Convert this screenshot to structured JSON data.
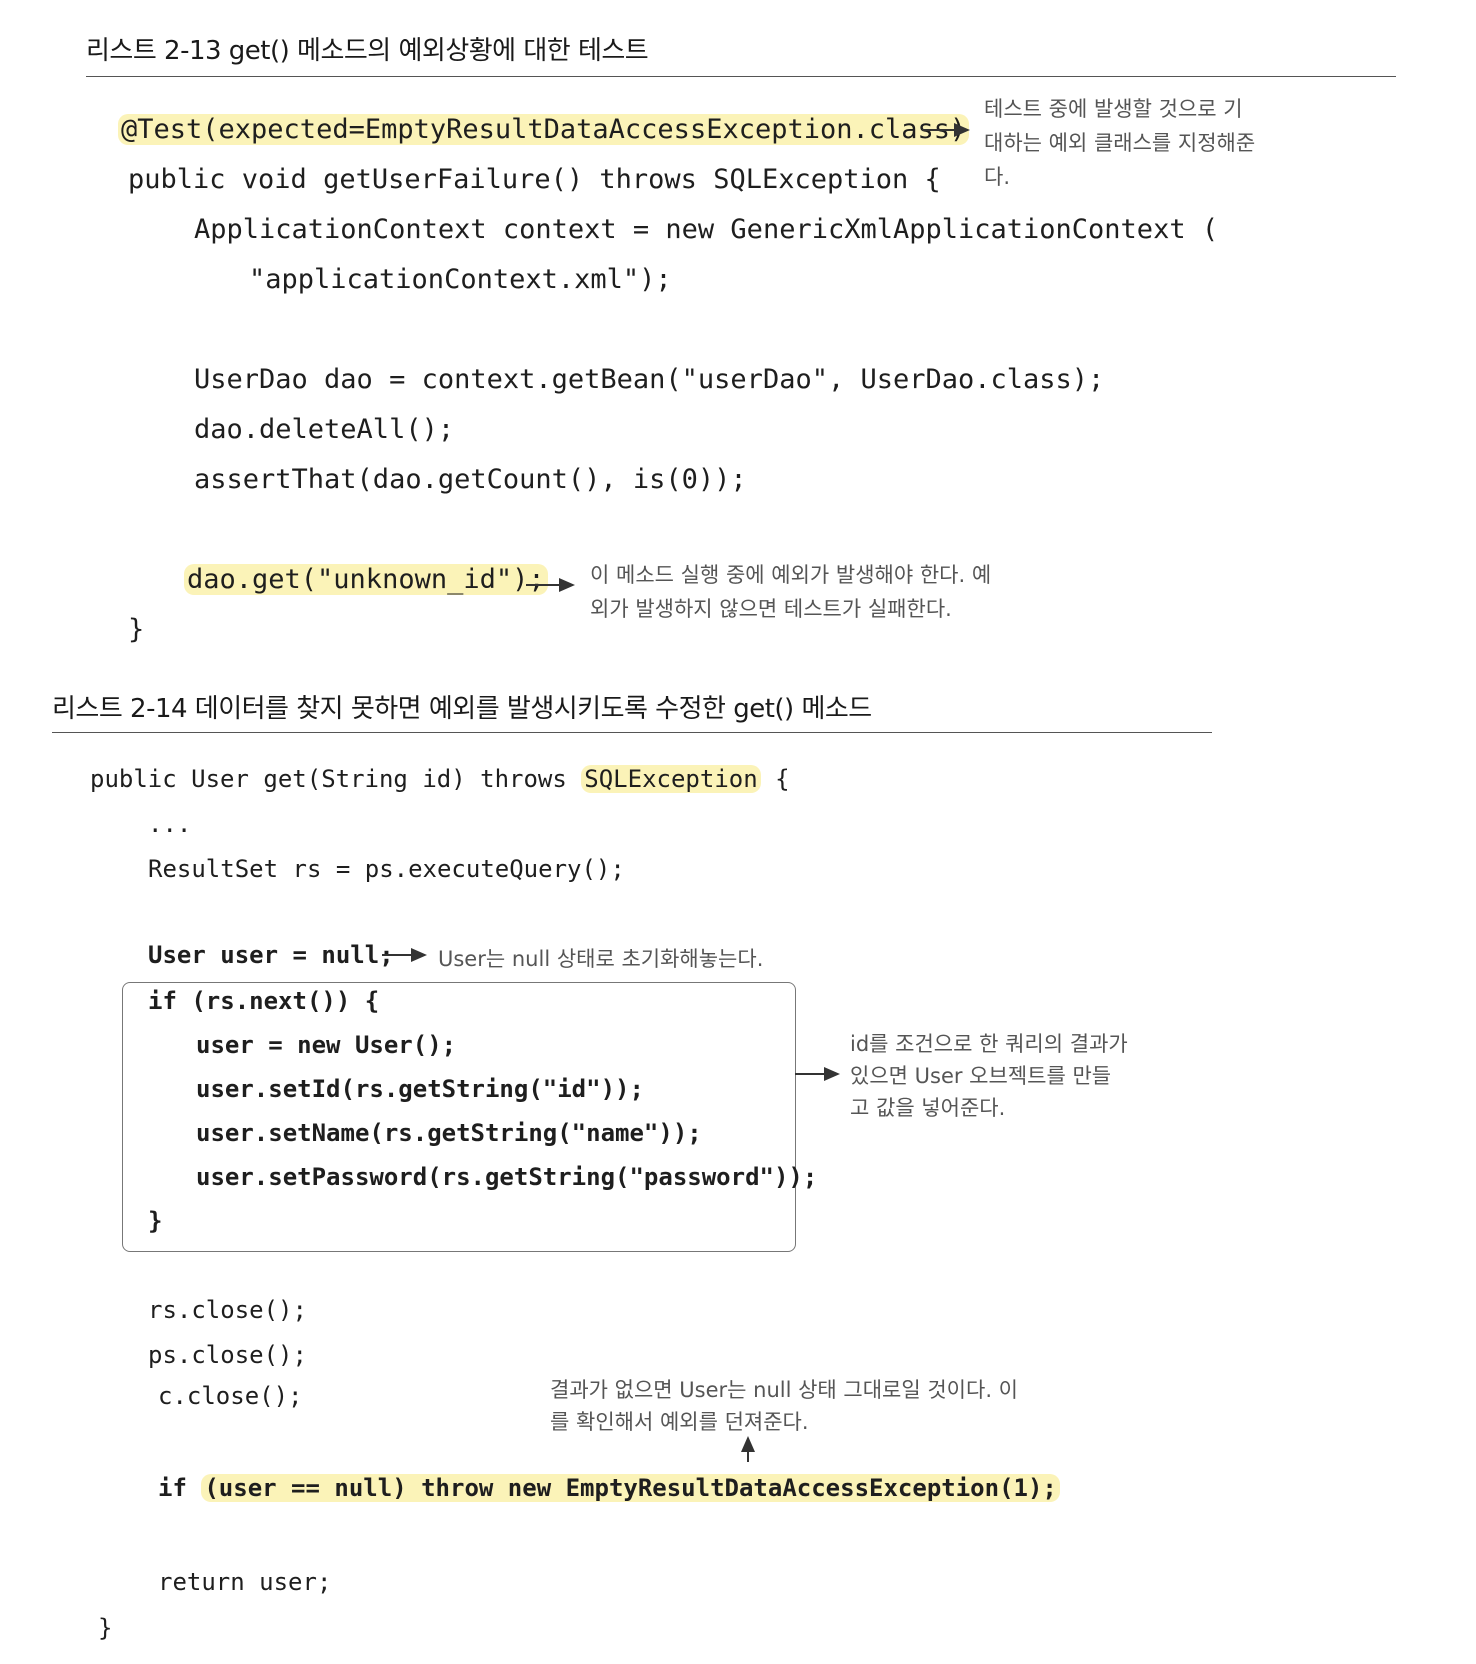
{
  "listing_2_13": {
    "title": "리스트 2-13 get() 메소드의 예외상황에 대한 테스트",
    "annotation_line": "@Test(expected=EmptyResultDataAccessException.class)",
    "signature": "public void getUserFailure() throws SQLException {",
    "context_line1": "ApplicationContext context = new GenericXmlApplicationContext (",
    "context_line2": "\"applicationContext.xml\");",
    "dao_line": "UserDao dao = context.getBean(\"userDao\", UserDao.class);",
    "delete_line": "dao.deleteAll();",
    "assert_line": "assertThat(dao.getCount(), is(0));",
    "get_call": "dao.get(\"unknown_id\");",
    "close_brace": "}",
    "note_expected": [
      "테스트 중에 발생할 것으로 기",
      "대하는 예외 클래스를 지정해준",
      "다."
    ],
    "note_get": [
      "이 메소드 실행 중에 예외가 발생해야 한다. 예",
      "외가 발생하지 않으면 테스트가 실패한다."
    ]
  },
  "listing_2_14": {
    "title": "리스트 2-14 데이터를 찾지 못하면 예외를 발생시키도록 수정한 get() 메소드",
    "signature_pre": "public User get(String id) throws ",
    "signature_exc": "SQLException",
    "signature_post": " {",
    "ellipsis": "...",
    "rs_line": "ResultSet rs = ps.executeQuery();",
    "user_null": "User user = null;",
    "if_next": "if (rs.next()) {",
    "new_user": "user = new User();",
    "set_id": "user.setId(rs.getString(\"id\"));",
    "set_name": "user.setName(rs.getString(\"name\"));",
    "set_password": "user.setPassword(rs.getString(\"password\"));",
    "if_close": "}",
    "rs_close": "rs.close();",
    "ps_close": "ps.close();",
    "c_close": "c.close();",
    "if_kw": "if ",
    "throw_line": "(user == null) throw new EmptyResultDataAccessException(1);",
    "return_line": "return user;",
    "close_brace": "}",
    "note_null": "User는 null 상태로 초기화해놓는다.",
    "note_block": [
      "id를 조건으로 한 쿼리의 결과가",
      "있으면 User 오브젝트를 만들",
      "고 값을 넣어준다."
    ],
    "note_throw": [
      "결과가 없으면 User는 null 상태 그대로일 것이다. 이",
      "를 확인해서 예외를 던져준다."
    ]
  }
}
